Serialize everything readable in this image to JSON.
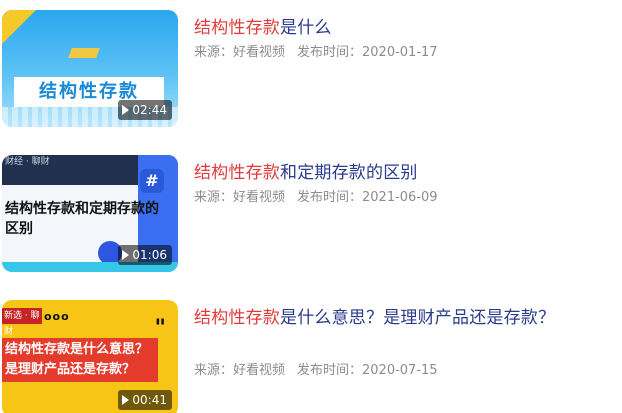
{
  "items": [
    {
      "thumb_text": "结构性存款",
      "duration": "02:44",
      "title_highlight": "结构性存款",
      "title_rest": "是什么",
      "source": "来源：好看视频",
      "publish": "发布时间：2020-01-17"
    },
    {
      "thumb_text": "结构性存款和定期存款的区别",
      "thumb_label": "财经 · 聊财",
      "thumb_tag": "#",
      "duration": "01:06",
      "title_highlight": "结构性存款",
      "title_rest": "和定期存款的区别",
      "source": "来源：好看视频",
      "publish": "发布时间：2021-06-09"
    },
    {
      "thumb_text": "结构性存款是什么意思？是理财产品还是存款？",
      "thumb_label": "新选 · 聊财",
      "thumb_dots": "ooo",
      "thumb_quote": "\"",
      "duration": "00:41",
      "title_highlight": "结构性存款",
      "title_rest": "是什么意思？是理财产品还是存款？",
      "source": "来源：好看视频",
      "publish": "发布时间：2020-07-15"
    }
  ],
  "icons": {
    "duration_icon": "play-icon"
  }
}
